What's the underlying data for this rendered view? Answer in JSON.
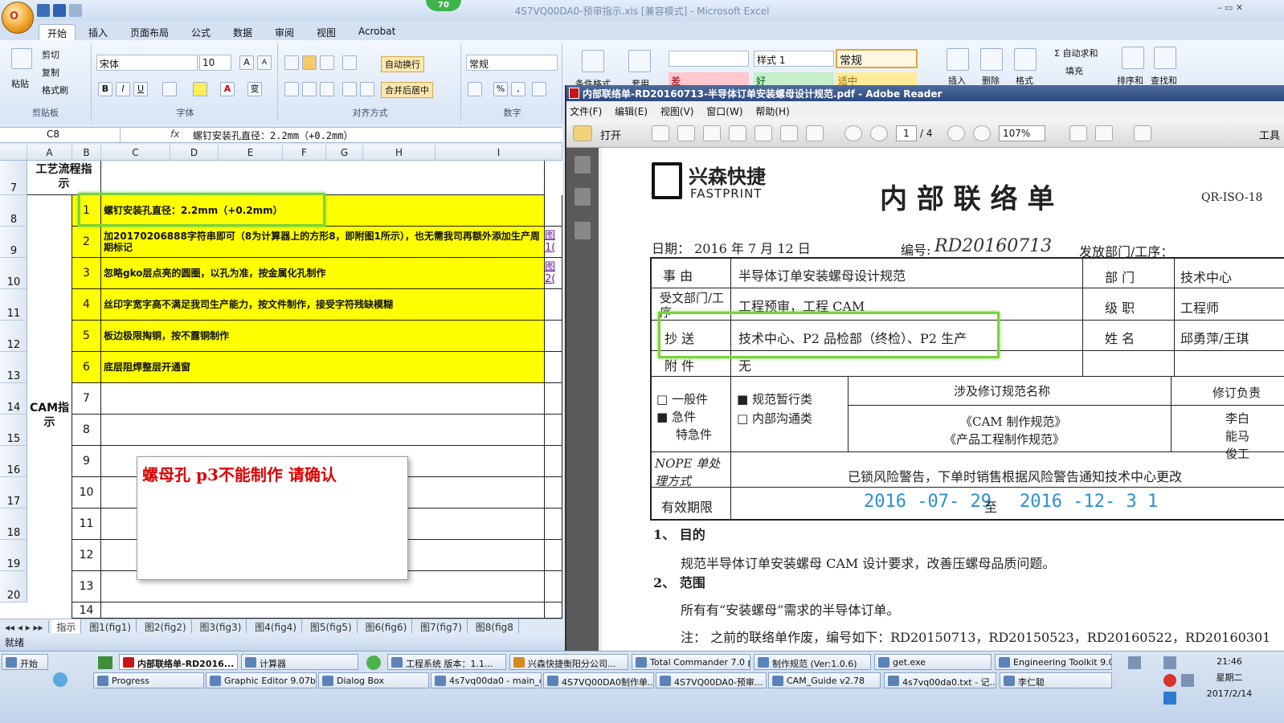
{
  "excel": {
    "title": "4S7VQ00DA0-预审指示.xls  [兼容模式] - Microsoft Excel",
    "badge": "70",
    "office_logo": "O",
    "window_controls": "–  ▭  ✕",
    "tabs": [
      "开始",
      "插入",
      "页面布局",
      "公式",
      "数据",
      "审阅",
      "视图",
      "Acrobat"
    ],
    "ribbon": {
      "paste": "粘贴",
      "cut": "剪切",
      "copy": "复制",
      "format_painter": "格式刷",
      "clipboard_group": "剪贴板",
      "font_name": "宋体",
      "font_size": "10",
      "font_group": "字体",
      "bold": "B",
      "italic": "I",
      "underline": "U",
      "grow": "A",
      "shrink": "A",
      "font_color": "A",
      "phonetic": "变",
      "wrap_text": "自动换行",
      "merge_center": "合并后居中",
      "alignment_group": "对齐方式",
      "number_format": "常规",
      "number_group": "数字",
      "percent": "%",
      "comma": ",",
      "cond_format": "条件格式",
      "table_format": "套用",
      "style1": "样式 1",
      "style_normal": "常规",
      "style_bad": "差",
      "style_good": "好",
      "style_neutral": "适中",
      "insert": "插入",
      "delete": "删除",
      "format": "格式",
      "autosum": "Σ 自动求和",
      "fill": "填充",
      "sort": "排序和",
      "find": "查找和"
    },
    "formula_bar": {
      "cell": "C8",
      "fx": "fx",
      "content": "螺钉安装孔直径：2.2mm（+0.2mm）"
    },
    "columns": [
      "A",
      "B",
      "C",
      "D",
      "E",
      "F",
      "G",
      "H",
      "I"
    ],
    "rows": [
      "7",
      "8",
      "9",
      "10",
      "11",
      "12",
      "13",
      "14",
      "15",
      "16",
      "17",
      "18",
      "19",
      "20"
    ],
    "a7": "工艺流程指示",
    "a_cam": "CAM指示",
    "items": [
      {
        "n": "1",
        "text": "螺钉安装孔直径：2.2mm（+0.2mm）",
        "link": ""
      },
      {
        "n": "2",
        "text": "加20170206888字符串即可（8为计算器上的方形8，即附图1所示），也无需我司再额外添加生产周期标记",
        "link": "图1("
      },
      {
        "n": "3",
        "text": "忽略gko层点亮的圆圈，以孔为准，按金属化孔制作",
        "link": "图2("
      },
      {
        "n": "4",
        "text": "丝印字宽字高不满足我司生产能力，按文件制作，接受字符残缺模糊",
        "link": ""
      },
      {
        "n": "5",
        "text": "板边极限掏铜，按不露铜制作",
        "link": ""
      },
      {
        "n": "6",
        "text": "底层阻焊整层开通窗",
        "link": ""
      },
      {
        "n": "7",
        "text": "",
        "link": ""
      },
      {
        "n": "8",
        "text": "",
        "link": ""
      },
      {
        "n": "9",
        "text": "",
        "link": ""
      },
      {
        "n": "10",
        "text": "",
        "link": ""
      },
      {
        "n": "11",
        "text": "",
        "link": ""
      },
      {
        "n": "12",
        "text": "",
        "link": ""
      },
      {
        "n": "13",
        "text": "",
        "link": ""
      },
      {
        "n": "14",
        "text": "",
        "link": ""
      }
    ],
    "comment": "螺母孔  p3不能制作  请确认",
    "sheet_nav": "◂◂ ◂ ▸ ▸▸",
    "sheet_tabs": [
      "指示",
      "图1(fig1)",
      "图2(fig2)",
      "图3(fig3)",
      "图4(fig4)",
      "图5(fig5)",
      "图6(fig6)",
      "图7(fig7)",
      "图8(fig8"
    ],
    "status": "就绪"
  },
  "reader": {
    "title": "内部联络单-RD20160713-半导体订单安装螺母设计规范.pdf - Adobe Reader",
    "menu": [
      "文件(F)",
      "编辑(E)",
      "视图(V)",
      "窗口(W)",
      "帮助(H)"
    ],
    "open": "打开",
    "page_current": "1",
    "page_total": "/ 4",
    "zoom": "107%",
    "tools": "工具",
    "doc": {
      "logo_cn": "兴森快捷",
      "logo_en": "FASTPRINT",
      "heading": "内 部 联 络 单",
      "form_no": "QR-ISO-18",
      "date": "日期：  2016 年 7 月 12 日",
      "number_label": "编号:",
      "number": "RD20160713",
      "dept_from": "发放部门/工序：",
      "subject_label": "事    由",
      "subject": "半导体订单安装螺母设计规范",
      "dept_label": "部    门",
      "dept": "技术中心",
      "recv_label": "受文部门/工序",
      "recv": "工程预审，工程 CAM",
      "level_label": "级    职",
      "level": "工程师",
      "cc_label": "抄    送",
      "cc": "技术中心、P2 品检部（终检）、P2 生产",
      "name_label": "姓    名",
      "name": "邱勇萍/王琪",
      "attach_label": "附    件",
      "attach": "无",
      "opt1": "□  一般件",
      "opt2": "■  急件",
      "opt3": "特急件",
      "opt4": "■  规范暂行类",
      "opt5": "□  内部沟通类",
      "rev_title": "涉及修订规范名称",
      "rev1": "《CAM 制作规范》",
      "rev2": "《产品工程制作规范》",
      "rev_resp": "修订负责",
      "rev_people": "李白能马俊工",
      "nope_label": "NOPE 单处理方式",
      "nope": "已锁风险警告，下单时销售根据风险警告通知技术中心更改",
      "valid_label": "有效期限",
      "valid_from": "2016 -07- 29",
      "valid_to_word": "至",
      "valid_to": "2016 -12- 3 1",
      "s1": "1、 目的",
      "s1_text": "规范半导体订单安装螺母 CAM 设计要求，改善压螺母品质问题。",
      "s2": "2、 范围",
      "s2_text": "所有有“安装螺母”需求的半导体订单。",
      "note": "注：  之前的联络单作废，编号如下：RD20150713，RD20150523，RD20160522，RD20160301"
    }
  },
  "taskbar": {
    "start": "开始",
    "row1": [
      "内部联络单-RD2016...",
      "计算器",
      "工程系统  版本：1.1...",
      "兴森快捷衡阳分公司...",
      "Total Commander 7.0 p...",
      "制作规范 (Ver:1.0.6)",
      "get.exe",
      "Engineering Toolkit 9.0..."
    ],
    "row2": [
      "Progress",
      "Graphic Editor 9.07b...",
      "Dialog Box",
      "4s7vq00da0 - main_qa",
      "4S7VQ00DA0制作单...",
      "4S7VQ00DA0-预审...",
      "CAM_Guide v2.78",
      "4s7vq00da0.txt - 记...",
      "李仁聪"
    ],
    "time": "21:46",
    "weekday": "星期二",
    "date": "2017/2/14"
  }
}
